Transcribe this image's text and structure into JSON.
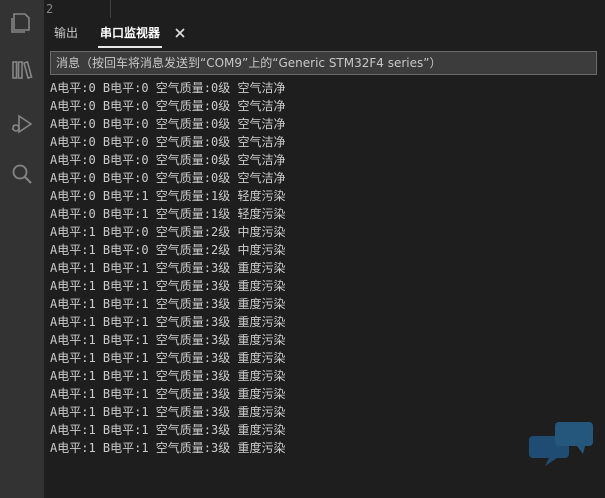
{
  "activity_bar": {
    "icons": [
      "explorer-icon",
      "library-icon",
      "debug-icon",
      "search-icon"
    ]
  },
  "editor": {
    "line_number": "2"
  },
  "panel": {
    "tabs": [
      {
        "label": "输出",
        "active": false
      },
      {
        "label": "串口监视器",
        "active": true
      }
    ],
    "close_icon": "close-icon",
    "message_placeholder": "消息（按回车将消息发送到“COM9”上的“Generic STM32F4 series”）"
  },
  "serial_lines": [
    "A电平:0 B电平:0 空气质量:0级 空气洁净",
    "A电平:0 B电平:0 空气质量:0级 空气洁净",
    "A电平:0 B电平:0 空气质量:0级 空气洁净",
    "A电平:0 B电平:0 空气质量:0级 空气洁净",
    "A电平:0 B电平:0 空气质量:0级 空气洁净",
    "A电平:0 B电平:0 空气质量:0级 空气洁净",
    "A电平:0 B电平:1 空气质量:1级 轻度污染",
    "A电平:0 B电平:1 空气质量:1级 轻度污染",
    "A电平:1 B电平:0 空气质量:2级 中度污染",
    "A电平:1 B电平:0 空气质量:2级 中度污染",
    "A电平:1 B电平:1 空气质量:3级 重度污染",
    "A电平:1 B电平:1 空气质量:3级 重度污染",
    "A电平:1 B电平:1 空气质量:3级 重度污染",
    "A电平:1 B电平:1 空气质量:3级 重度污染",
    "A电平:1 B电平:1 空气质量:3级 重度污染",
    "A电平:1 B电平:1 空气质量:3级 重度污染",
    "A电平:1 B电平:1 空气质量:3级 重度污染",
    "A电平:1 B电平:1 空气质量:3级 重度污染",
    "A电平:1 B电平:1 空气质量:3级 重度污染",
    "A电平:1 B电平:1 空气质量:3级 重度污染",
    "A电平:1 B电平:1 空气质量:3级 重度污染"
  ],
  "colors": {
    "background": "#1e1e1e",
    "activity_bar": "#333333",
    "text": "#cccccc",
    "watermark": "#1f73b7"
  }
}
